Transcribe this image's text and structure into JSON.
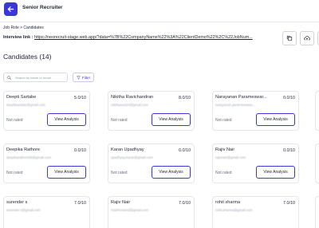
{
  "header": {
    "title": "Senior Recruiter",
    "accent": "#3a36d9"
  },
  "breadcrumb": "Job Role > Candidates",
  "interview": {
    "label": "Interview link :",
    "url": "https://neorecruit-stage.web.app/?data=%7B%22CompanyName%22%3A%22ClientDemo%22%2C%22JobNum..."
  },
  "candidates_title": "Candidates (14)",
  "search": {
    "placeholder": "Search by name or email"
  },
  "filter": {
    "label": "Filter"
  },
  "candidates": [
    {
      "name": "Deepti Sartabe",
      "score": "5.0/10",
      "email": "deeptisartabe@gmail.com",
      "rating": "Not rated",
      "action": "View Analysis"
    },
    {
      "name": "Nikitha Ravichandran",
      "score": "8.0/10",
      "email": "nikitharavi24@gmail.com",
      "rating": "Not rated",
      "action": "View Analysis"
    },
    {
      "name": "Narayanan Parameswar...",
      "score": "0.0/10",
      "email": "narayanan.parameswara...",
      "rating": "Not rated",
      "action": "View Analysis"
    },
    {
      "name": "Deepika Rathore",
      "score": "0.0/10",
      "email": "deepikarathore99@gmail.com",
      "rating": "Not rated",
      "action": "View Analysis"
    },
    {
      "name": "Karan Upadhyay",
      "score": "0.0/10",
      "email": "upadhyay.karan@gmail.com",
      "rating": "Not rated",
      "action": "View Analysis"
    },
    {
      "name": "Rajiv Nair",
      "score": "0.0/10",
      "email": "rajivnair@gmail.com",
      "rating": "Not rated",
      "action": "View Analysis"
    },
    {
      "name": "surender s",
      "score": "7.0/10",
      "email": "surender.s@gmail.com",
      "rating": "",
      "action": ""
    },
    {
      "name": "Rajiv Nair",
      "score": "7.0/10",
      "email": "rnairfrontend@gmail.com",
      "rating": "",
      "action": ""
    },
    {
      "name": "rohit sharma",
      "score": "7.0/10",
      "email": "rohit.sharma@gmail.com",
      "rating": "",
      "action": ""
    }
  ]
}
